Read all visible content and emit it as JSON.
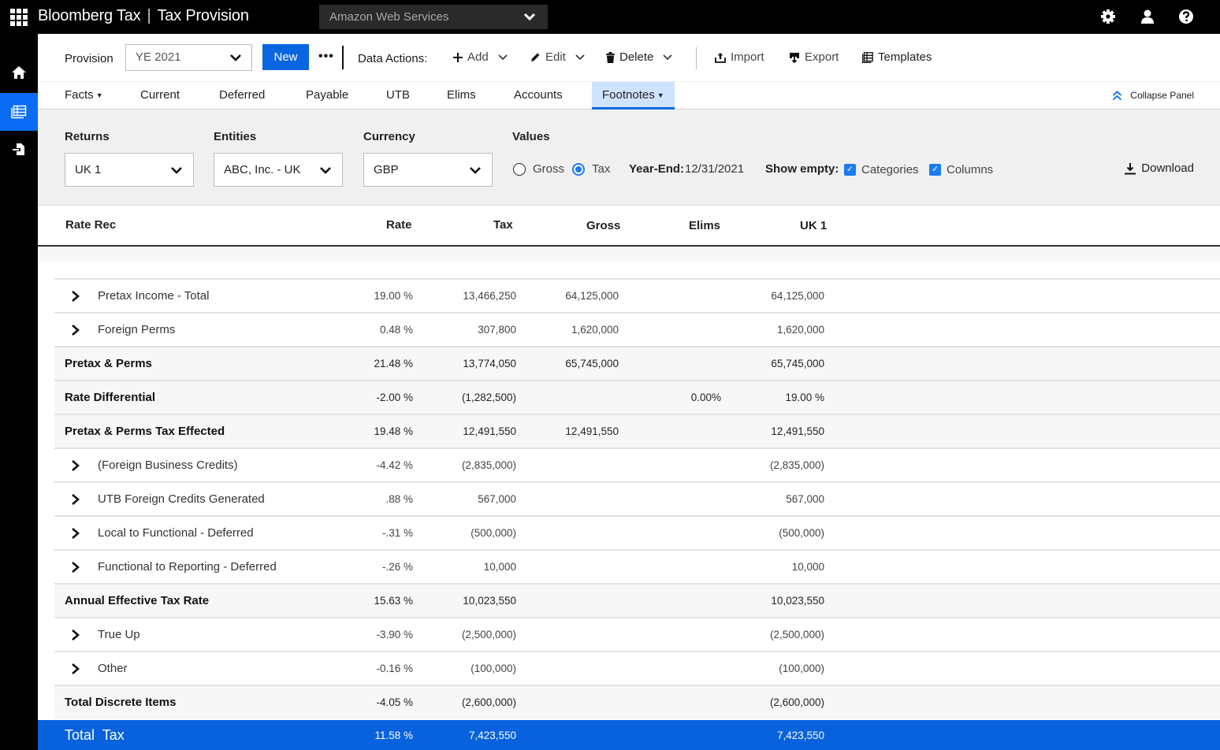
{
  "app": {
    "brand": "Bloomberg Tax",
    "product": "Tax Provision",
    "company": "Amazon Web Services"
  },
  "topbar_icons": [
    "gear-icon",
    "user-icon",
    "help-icon"
  ],
  "rail": [
    {
      "icon": "home-icon",
      "active": false
    },
    {
      "icon": "table-icon",
      "active": true
    },
    {
      "icon": "export-icon",
      "active": false
    }
  ],
  "toolbar": {
    "provision_label": "Provision",
    "provision_value": "YE 2021",
    "new_label": "New",
    "more_label": "•••",
    "data_actions_label": "Data Actions:",
    "add_label": "Add",
    "edit_label": "Edit",
    "delete_label": "Delete",
    "import_label": "Import",
    "export_label": "Export",
    "templates_label": "Templates"
  },
  "tabs": [
    {
      "label": "Facts",
      "dropdown": true
    },
    {
      "label": "Current"
    },
    {
      "label": "Deferred"
    },
    {
      "label": "Payable"
    },
    {
      "label": "UTB"
    },
    {
      "label": "Elims"
    },
    {
      "label": "Accounts"
    },
    {
      "label": "Footnotes",
      "dropdown": true,
      "active": true
    }
  ],
  "collapse_label": "Collapse Panel",
  "filters": {
    "returns_label": "Returns",
    "returns_value": "UK 1",
    "entities_label": "Entities",
    "entities_value": "ABC, Inc. - UK",
    "currency_label": "Currency",
    "currency_value": "GBP",
    "values_label": "Values",
    "gross_label": "Gross",
    "tax_label": "Tax",
    "selected_value": "Tax",
    "year_end_label": "Year-End:",
    "year_end_value": "12/31/2021",
    "show_empty_label": "Show empty:",
    "categories_label": "Categories",
    "categories_checked": true,
    "columns_label": "Columns",
    "columns_checked": true,
    "download_label": "Download"
  },
  "table": {
    "columns": [
      "Rate Rec",
      "Rate",
      "Tax",
      "Gross",
      "Elims",
      "UK 1"
    ],
    "rows": [
      {
        "label": "Pretax Income - Total",
        "expandable": true,
        "rate": "19.00 %",
        "tax": "13,466,250",
        "gross": "64,125,000",
        "elims": "",
        "uk1": "64,125,000"
      },
      {
        "label": "Foreign Perms",
        "expandable": true,
        "rate": "0.48 %",
        "tax": "307,800",
        "gross": "1,620,000",
        "elims": "",
        "uk1": "1,620,000"
      },
      {
        "label": "Pretax & Perms",
        "subtotal": true,
        "rate": "21.48 %",
        "tax": "13,774,050",
        "gross": "65,745,000",
        "elims": "",
        "uk1": "65,745,000"
      },
      {
        "label": "Rate Differential",
        "subtotal": true,
        "rate": "-2.00 %",
        "tax": "(1,282,500)",
        "gross": "",
        "elims": "0.00%",
        "uk1": "19.00 %"
      },
      {
        "label": "Pretax & Perms Tax Effected",
        "subtotal": true,
        "rate": "19.48 %",
        "tax": "12,491,550",
        "gross": "12,491,550",
        "elims": "",
        "uk1": "12,491,550"
      },
      {
        "label": "(Foreign Business Credits)",
        "expandable": true,
        "rate": "-4.42 %",
        "tax": "(2,835,000)",
        "gross": "",
        "elims": "",
        "uk1": "(2,835,000)"
      },
      {
        "label": "UTB Foreign Credits Generated",
        "expandable": true,
        "rate": ".88 %",
        "tax": "567,000",
        "gross": "",
        "elims": "",
        "uk1": "567,000"
      },
      {
        "label": "Local to Functional - Deferred",
        "expandable": true,
        "rate": "-.31 %",
        "tax": "(500,000)",
        "gross": "",
        "elims": "",
        "uk1": "(500,000)"
      },
      {
        "label": "Functional to Reporting - Deferred",
        "expandable": true,
        "rate": "-.26 %",
        "tax": "10,000",
        "gross": "",
        "elims": "",
        "uk1": "10,000"
      },
      {
        "label": "Annual Effective Tax Rate",
        "subtotal": true,
        "rate": "15.63 %",
        "tax": "10,023,550",
        "gross": "",
        "elims": "",
        "uk1": "10,023,550"
      },
      {
        "label": "True Up",
        "expandable": true,
        "rate": "-3.90 %",
        "tax": "(2,500,000)",
        "gross": "",
        "elims": "",
        "uk1": "(2,500,000)"
      },
      {
        "label": "Other",
        "expandable": true,
        "rate": "-0.16 %",
        "tax": "(100,000)",
        "gross": "",
        "elims": "",
        "uk1": "(100,000)"
      },
      {
        "label": "Total Discrete Items",
        "subtotal": true,
        "rate": "-4.05 %",
        "tax": "(2,600,000)",
        "gross": "",
        "elims": "",
        "uk1": "(2,600,000)"
      }
    ],
    "total": {
      "label": "Total  Tax",
      "rate": "11.58 %",
      "tax": "7,423,550",
      "uk1": "7,423,550"
    }
  },
  "colors": {
    "accent": "#0a66e0",
    "active_tab_bg": "#cfe3ff",
    "total_row_bg": "#0862de",
    "topbar_bg": "#000000"
  }
}
